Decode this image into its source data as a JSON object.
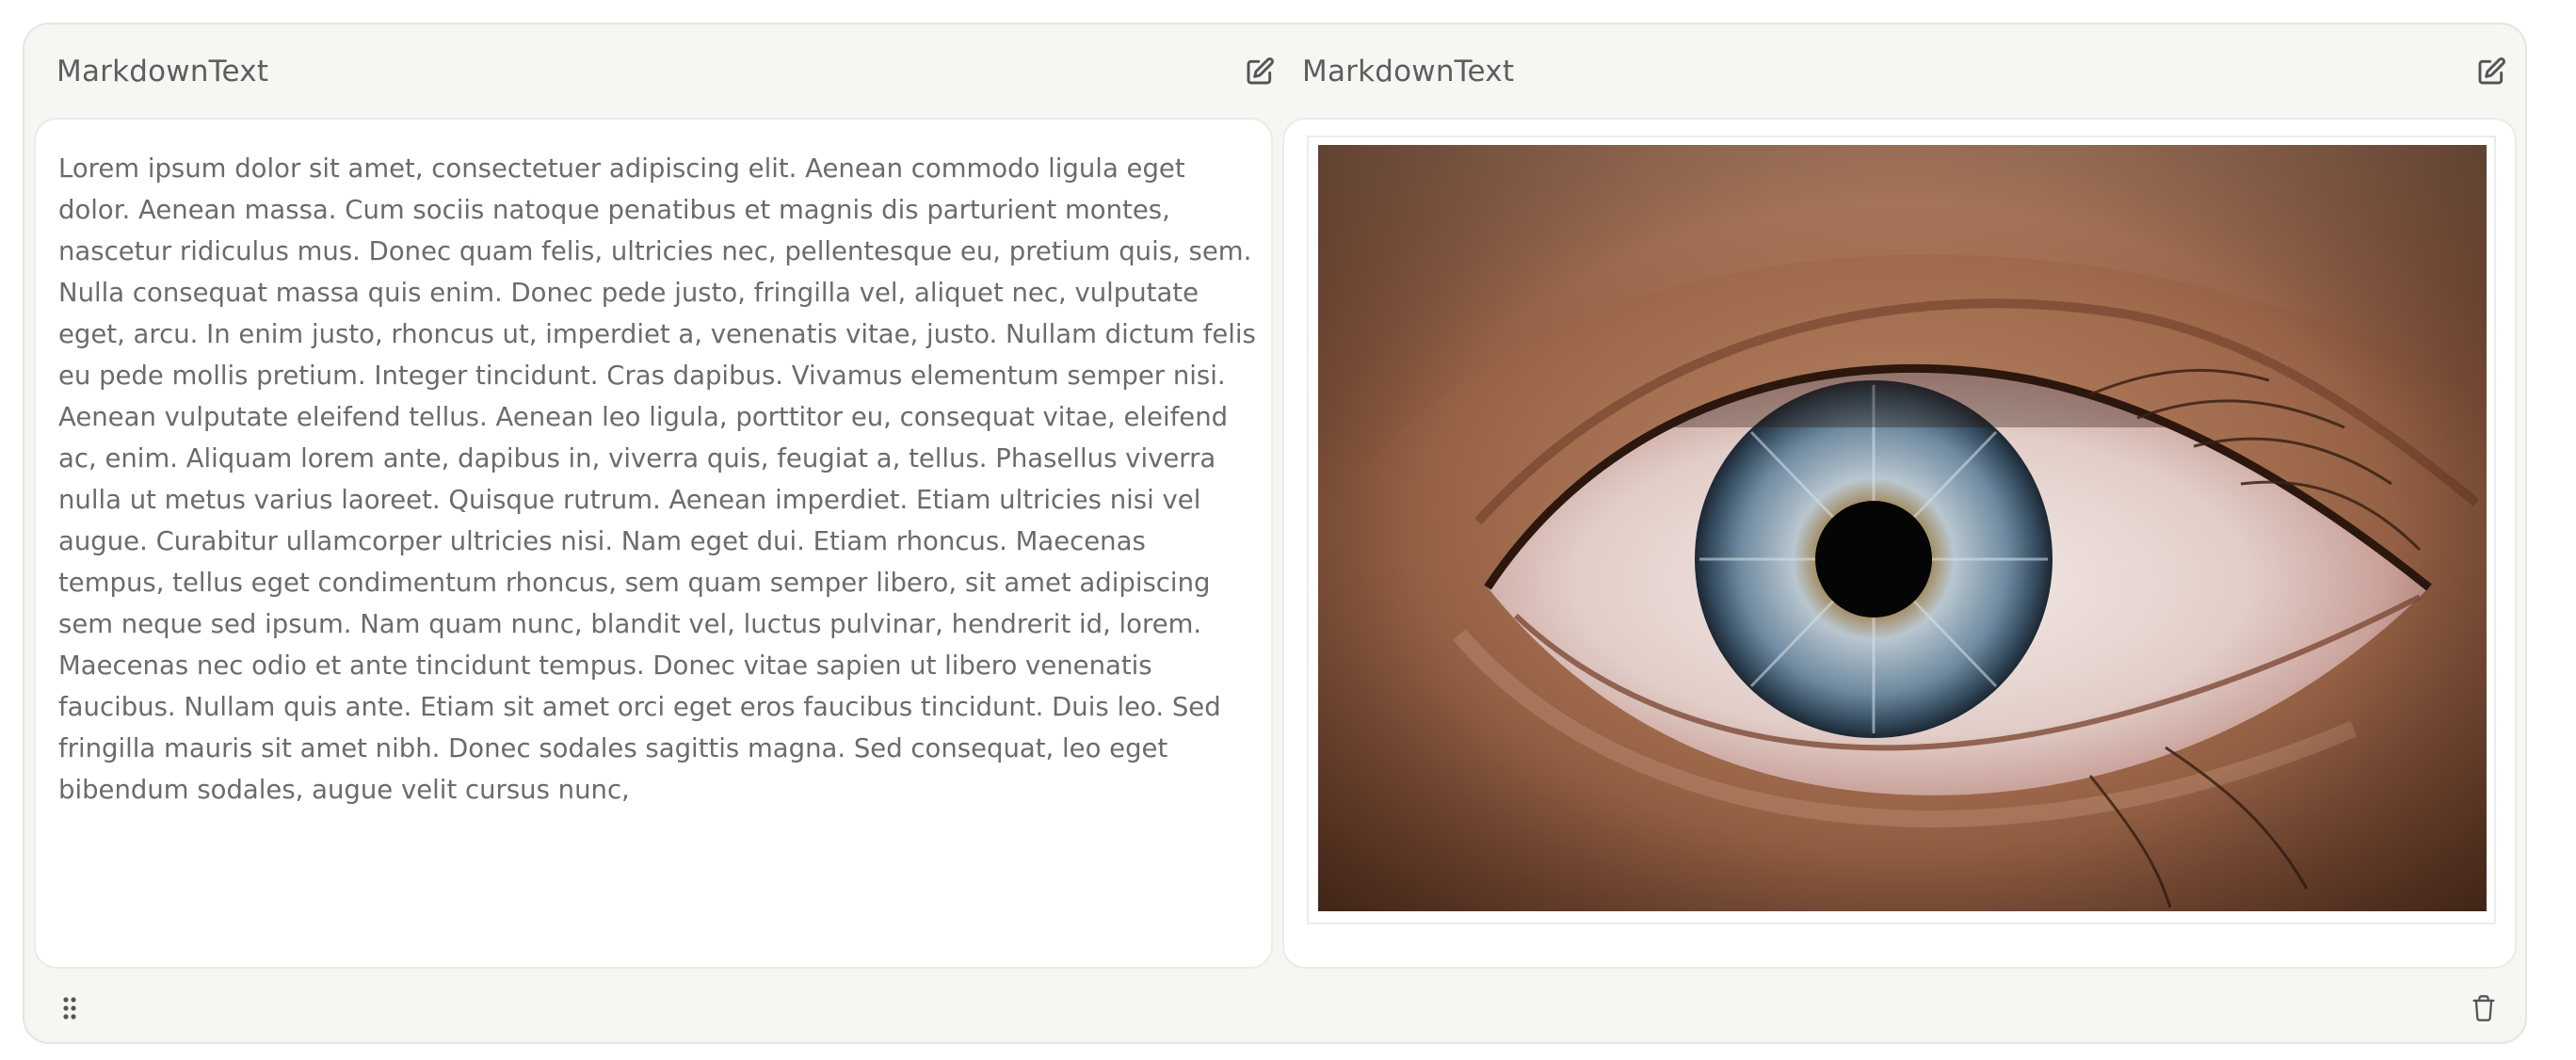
{
  "panels": [
    {
      "title": "MarkdownText",
      "edit_icon": "edit-icon",
      "content_type": "text",
      "text": "Lorem ipsum dolor sit amet, consectetuer adipiscing elit. Aenean commodo ligula eget dolor. Aenean massa. Cum sociis natoque penatibus et magnis dis parturient montes, nascetur ridiculus mus. Donec quam felis, ultricies nec, pellentesque eu, pretium quis, sem. Nulla consequat massa quis enim. Donec pede justo, fringilla vel, aliquet nec, vulputate eget, arcu. In enim justo, rhoncus ut, imperdiet a, venenatis vitae, justo. Nullam dictum felis eu pede mollis pretium. Integer tincidunt. Cras dapibus. Vivamus elementum semper nisi. Aenean vulputate eleifend tellus. Aenean leo ligula, porttitor eu, consequat vitae, eleifend ac, enim. Aliquam lorem ante, dapibus in, viverra quis, feugiat a, tellus. Phasellus viverra nulla ut metus varius laoreet. Quisque rutrum. Aenean imperdiet. Etiam ultricies nisi vel augue. Curabitur ullamcorper ultricies nisi. Nam eget dui. Etiam rhoncus. Maecenas tempus, tellus eget condimentum rhoncus, sem quam semper libero, sit amet adipiscing sem neque sed ipsum. Nam quam nunc, blandit vel, luctus pulvinar, hendrerit id, lorem. Maecenas nec odio et ante tincidunt tempus. Donec vitae sapien ut libero venenatis faucibus. Nullam quis ante. Etiam sit amet orci eget eros faucibus tincidunt. Duis leo. Sed fringilla mauris sit amet nibh. Donec sodales sagittis magna. Sed consequat, leo eget bibendum sodales, augue velit cursus nunc,"
    },
    {
      "title": "MarkdownText",
      "edit_icon": "edit-icon",
      "content_type": "image",
      "image_subject": "close-up of a blue-grey human eye"
    }
  ],
  "footer": {
    "drag_icon": "drag-handle-icon",
    "delete_icon": "trash-icon"
  },
  "colors": {
    "card_background": "#f6f6f3",
    "panel_background": "#ffffff",
    "text": "#6b6b6b",
    "title": "#5e5e5e",
    "icon": "#555555"
  }
}
